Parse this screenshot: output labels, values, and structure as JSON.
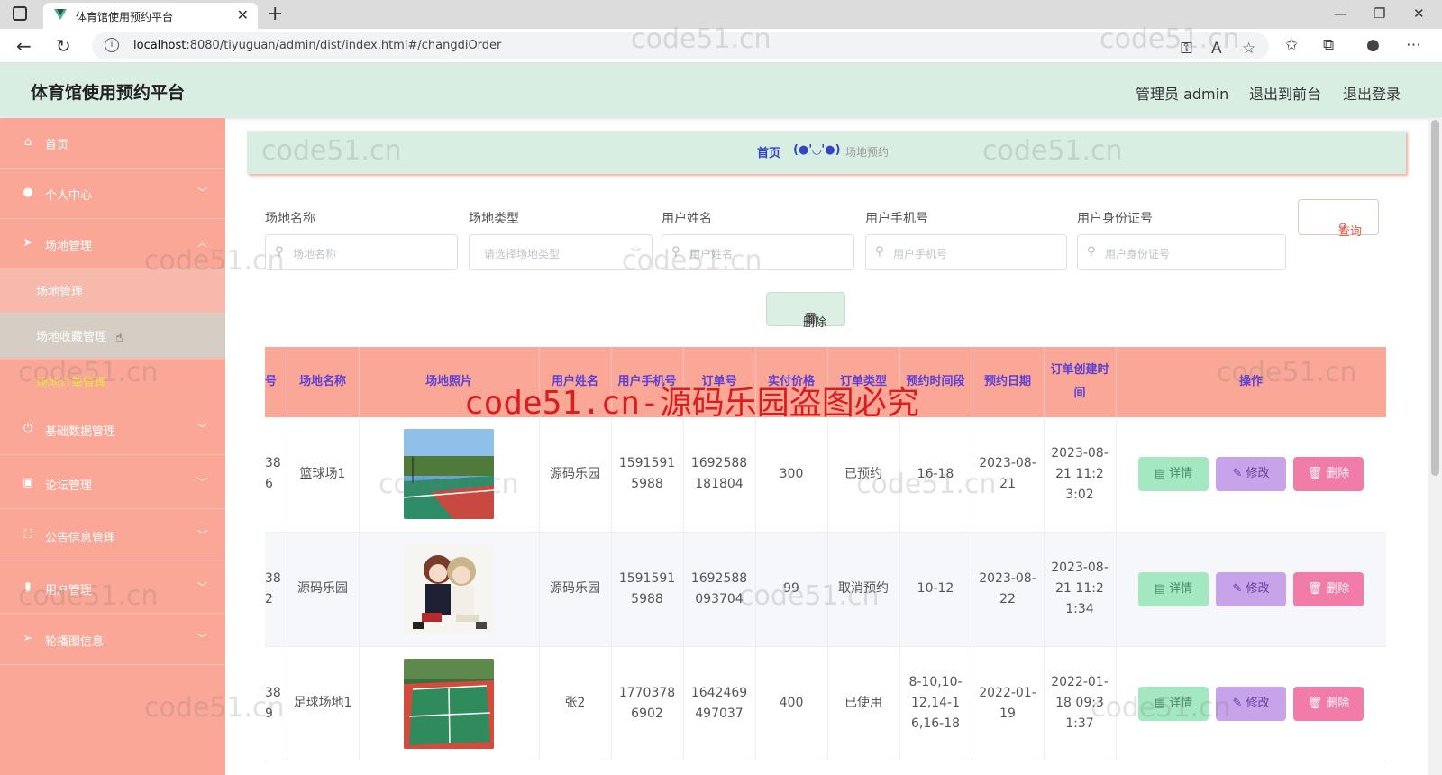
{
  "browser": {
    "tab_title": "体育馆使用预约平台",
    "url_host": "localhost",
    "url_path": ":8080/tiyuguan/admin/dist/index.html#/changdiOrder"
  },
  "header": {
    "title": "体育馆使用预约平台",
    "admin_label": "管理员 admin",
    "front_label": "退出到前台",
    "logout_label": "退出登录"
  },
  "sidebar": {
    "items": [
      {
        "label": "首页",
        "icon": "home-icon"
      },
      {
        "label": "个人中心",
        "icon": "user-icon"
      },
      {
        "label": "场地管理",
        "icon": "send-icon"
      },
      {
        "label": "基础数据管理",
        "icon": "power-icon"
      },
      {
        "label": "论坛管理",
        "icon": "chat-icon"
      },
      {
        "label": "公告信息管理",
        "icon": "notice-icon"
      },
      {
        "label": "用户管理",
        "icon": "bar-chart-icon"
      },
      {
        "label": "轮播图信息",
        "icon": "navigation-icon"
      }
    ],
    "sub_items": [
      {
        "label": "场地管理"
      },
      {
        "label": "场地收藏管理"
      }
    ],
    "highlight": "场地订单管理"
  },
  "breadcrumb": {
    "home": "首页",
    "separator": "(●'◡'●)",
    "current": "场地预约"
  },
  "search": {
    "fields": [
      {
        "label": "场地名称",
        "placeholder": "场地名称"
      },
      {
        "label": "场地类型",
        "placeholder": "请选择场地类型"
      },
      {
        "label": "用户姓名",
        "placeholder": "用户姓名"
      },
      {
        "label": "用户手机号",
        "placeholder": "用户手机号"
      },
      {
        "label": "用户身份证号",
        "placeholder": "用户身份证号"
      }
    ],
    "query_label": "查询",
    "delete_label": "删除"
  },
  "table": {
    "columns": [
      "号",
      "场地名称",
      "场地照片",
      "用户姓名",
      "用户手机号",
      "订单号",
      "实付价格",
      "订单类型",
      "预约时间段",
      "预约日期",
      "订单创建时间",
      "操作"
    ],
    "rows": [
      {
        "id": "386",
        "name": "篮球场1",
        "photo": "court-photo-basketball",
        "user": "源码乐园",
        "phone": "15915915988",
        "order": "1692588181804",
        "price": "300",
        "type": "已预约",
        "slot": "16-18",
        "date": "2023-08-21",
        "created": "2023-08-21 11:23:02"
      },
      {
        "id": "382",
        "name": "源码乐园",
        "photo": "court-photo-anime",
        "user": "源码乐园",
        "phone": "15915915988",
        "order": "1692588093704",
        "price": "99",
        "type": "取消预约",
        "slot": "10-12",
        "date": "2023-08-22",
        "created": "2023-08-21 11:21:34"
      },
      {
        "id": "389",
        "name": "足球场地1",
        "photo": "court-photo-soccer",
        "user": "张2",
        "phone": "17703786902",
        "order": "1642469497037",
        "price": "400",
        "type": "已使用",
        "slot": "8-10,10-12,14-16,16-18",
        "date": "2022-01-19",
        "created": "2022-01-18 09:31:37"
      }
    ],
    "actions": {
      "detail": "详情",
      "edit": "修改",
      "delete": "删除"
    }
  },
  "watermark": {
    "text": "code51.cn",
    "banner": "code51.cn-源码乐园盗图必究"
  },
  "colors": {
    "sidebar": "#fba797",
    "header": "#d9eee3",
    "accent": "#5b3fd6"
  }
}
